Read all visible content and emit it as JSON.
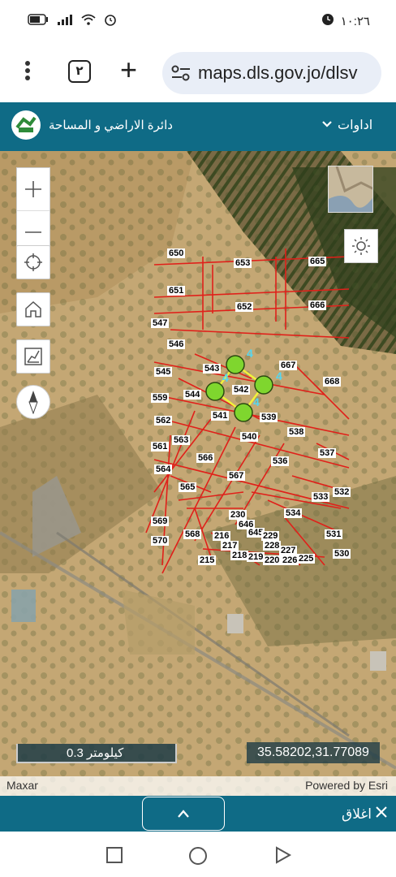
{
  "status": {
    "time": "١٠:٢٦",
    "icons": [
      "alarm-icon",
      "wifi-icon",
      "signal-icon",
      "battery-icon"
    ]
  },
  "browser": {
    "tab_count": "٢",
    "url": "maps.dls.gov.jo/dlsv"
  },
  "app": {
    "title": "دائرة الاراضي و المساحة",
    "tools_label": "اداوات"
  },
  "map": {
    "scale_label": "0.3 كيلومتر",
    "coordinates": "35.58202,31.77089",
    "attribution_left": "Maxar",
    "attribution_right": "Powered by Esri",
    "parcels": [
      "650",
      "653",
      "665",
      "651",
      "652",
      "666",
      "547",
      "546",
      "667",
      "545",
      "543",
      "542",
      "668",
      "544",
      "559",
      "541",
      "539",
      "562",
      "538",
      "540",
      "563",
      "561",
      "537",
      "566",
      "536",
      "567",
      "564",
      "565",
      "533",
      "532",
      "534",
      "230",
      "569",
      "646",
      "568",
      "216",
      "645",
      "229",
      "531",
      "570",
      "217",
      "228",
      "227",
      "218",
      "219",
      "220",
      "226",
      "225",
      "530",
      "215"
    ]
  },
  "footer": {
    "close_label": "اغلاق"
  },
  "colors": {
    "header": "#0f6b86",
    "parcel_line": "#e0201a",
    "marker": "#7fd62e"
  }
}
